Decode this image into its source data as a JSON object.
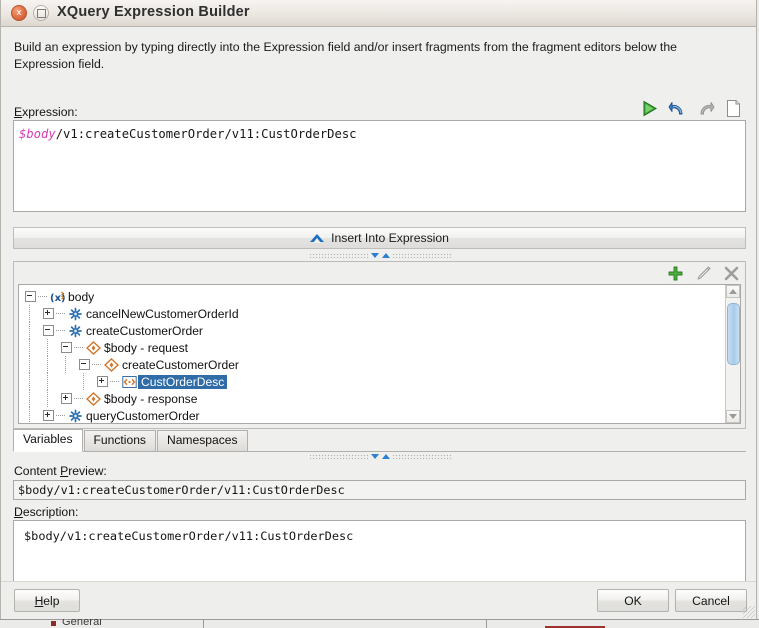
{
  "window": {
    "title": "XQuery Expression Builder",
    "close_icon": "close-icon",
    "maximize_icon": "maximize-icon"
  },
  "instructions": "Build an expression by typing directly into the Expression field and/or insert fragments from the fragment editors below the Expression field.",
  "expression": {
    "label_mn": "E",
    "label_rest": "xpression:",
    "variable": "$body",
    "path": "/v1:createCustomerOrder/v11:CustOrderDesc",
    "tools": [
      {
        "name": "run-expression-icon",
        "label": "Run"
      },
      {
        "name": "undo-icon",
        "label": "Undo"
      },
      {
        "name": "redo-icon",
        "label": "Redo"
      },
      {
        "name": "new-document-icon",
        "label": "New"
      }
    ]
  },
  "insert_button": {
    "label": "Insert Into Expression",
    "icon": "chevron-up-icon"
  },
  "tree_tools": [
    {
      "name": "add-icon",
      "label": "Add"
    },
    {
      "name": "edit-icon",
      "label": "Edit"
    },
    {
      "name": "delete-icon",
      "label": "Delete"
    }
  ],
  "tree": {
    "rows": [
      {
        "indent": 0,
        "expander": "minus",
        "icon": "variable-icon",
        "label": "body",
        "selected": false
      },
      {
        "indent": 1,
        "expander": "plus",
        "icon": "operation-icon",
        "label": "cancelNewCustomerOrderId",
        "selected": false
      },
      {
        "indent": 1,
        "expander": "minus",
        "icon": "operation-icon",
        "label": "createCustomerOrder",
        "selected": false
      },
      {
        "indent": 2,
        "expander": "minus",
        "icon": "message-icon",
        "label": "$body - request",
        "selected": false
      },
      {
        "indent": 3,
        "expander": "minus",
        "icon": "message-icon",
        "label": "createCustomerOrder",
        "selected": false
      },
      {
        "indent": 4,
        "expander": "plus",
        "icon": "element-icon",
        "label": "CustOrderDesc",
        "selected": true
      },
      {
        "indent": 2,
        "expander": "plus",
        "icon": "message-icon",
        "label": "$body - response",
        "selected": false
      },
      {
        "indent": 1,
        "expander": "plus",
        "icon": "operation-icon",
        "label": "queryCustomerOrder",
        "selected": false
      }
    ],
    "scrollbar": {
      "up_icon": "scroll-up-arrow-icon",
      "down_icon": "scroll-down-arrow-icon"
    }
  },
  "tabs": [
    {
      "label": "Variables",
      "active": true
    },
    {
      "label": "Functions",
      "active": false
    },
    {
      "label": "Namespaces",
      "active": false
    }
  ],
  "content_preview": {
    "label_pre": "Content ",
    "label_mn": "P",
    "label_rest": "review:",
    "value": "$body/v1:createCustomerOrder/v11:CustOrderDesc"
  },
  "description": {
    "label_mn": "D",
    "label_rest": "escription:",
    "value": "$body/v1:createCustomerOrder/v11:CustOrderDesc"
  },
  "footer": {
    "help_mn": "H",
    "help_rest": "elp",
    "ok": "OK",
    "cancel": "Cancel"
  },
  "background": {
    "tab_label": "General"
  },
  "colors": {
    "accent_blue": "#2f6ca8",
    "variable_pink": "#d63fb5",
    "title_bar": "#eae5df",
    "dialog_bg": "#efefed"
  }
}
